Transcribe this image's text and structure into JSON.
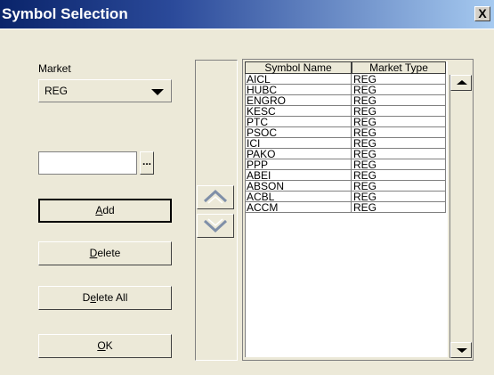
{
  "window": {
    "title": "Symbol Selection",
    "close_glyph": "X"
  },
  "market": {
    "label": "Market",
    "selected": "REG"
  },
  "symbol_input": {
    "value": "",
    "browse_label": "..."
  },
  "buttons": {
    "add": {
      "label": "Add",
      "accel": "A",
      "rest": "dd"
    },
    "delete": {
      "label": "Delete",
      "accel": "D",
      "rest": "elete"
    },
    "delete_all": {
      "label": "Delete All",
      "pre": "D",
      "accel": "e",
      "rest": "lete All"
    },
    "ok": {
      "label": "OK",
      "accel": "O",
      "rest": "K"
    }
  },
  "icons": {
    "move_up": "chevron-up-icon",
    "move_down": "chevron-down-icon",
    "scroll_up": "scroll-up-icon",
    "scroll_down": "scroll-down-icon"
  },
  "grid": {
    "columns": [
      "Symbol Name",
      "Market Type"
    ],
    "rows": [
      [
        "AICL",
        "REG"
      ],
      [
        "HUBC",
        "REG"
      ],
      [
        "ENGRO",
        "REG"
      ],
      [
        "KESC",
        "REG"
      ],
      [
        "PTC",
        "REG"
      ],
      [
        "PSOC",
        "REG"
      ],
      [
        "ICI",
        "REG"
      ],
      [
        "PAKO",
        "REG"
      ],
      [
        "PPP",
        "REG"
      ],
      [
        "ABEI",
        "REG"
      ],
      [
        "ABSON",
        "REG"
      ],
      [
        "ACBL",
        "REG"
      ],
      [
        "ACCM",
        "REG"
      ]
    ]
  },
  "colors": {
    "title_start": "#0a246a",
    "title_end": "#a6caf0",
    "face": "#ece9d8"
  }
}
